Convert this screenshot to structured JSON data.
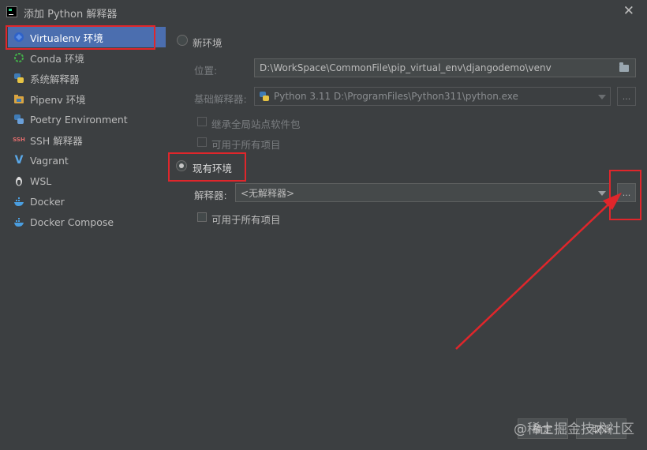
{
  "window": {
    "title": "添加 Python 解释器",
    "close_symbol": "✕"
  },
  "sidebar": {
    "items": [
      {
        "label": "Virtualenv 环境",
        "icon": "virtualenv-icon"
      },
      {
        "label": "Conda 环境",
        "icon": "conda-icon"
      },
      {
        "label": "系统解释器",
        "icon": "python-icon"
      },
      {
        "label": "Pipenv 环境",
        "icon": "pipenv-icon"
      },
      {
        "label": "Poetry Environment",
        "icon": "poetry-icon"
      },
      {
        "label": "SSH 解释器",
        "icon": "ssh-icon"
      },
      {
        "label": "Vagrant",
        "icon": "vagrant-icon"
      },
      {
        "label": "WSL",
        "icon": "linux-icon"
      },
      {
        "label": "Docker",
        "icon": "docker-icon"
      },
      {
        "label": "Docker Compose",
        "icon": "docker-compose-icon"
      }
    ],
    "ssh_icon_text": "SSH",
    "vagrant_icon_text": "V"
  },
  "new_env": {
    "radio_label": "新环境",
    "location_label": "位置:",
    "location_value": "D:\\WorkSpace\\CommonFile\\pip_virtual_env\\djangodemo\\venv",
    "base_label": "基础解释器:",
    "base_value": "Python 3.11 D:\\ProgramFiles\\Python311\\python.exe",
    "inherit_label": "继承全局站点软件包",
    "all_projects_label": "可用于所有项目"
  },
  "existing_env": {
    "radio_label": "现有环境",
    "interpreter_label": "解释器:",
    "interpreter_value": "<无解释器>",
    "all_projects_label": "可用于所有项目"
  },
  "buttons": {
    "browse_label": "...",
    "ok_label": "确定",
    "cancel_label": "取消"
  },
  "watermark": "@稀土掘金技术社区",
  "colors": {
    "background": "#3c3f41",
    "selection": "#4b6eaf",
    "highlight_red": "#e0262b"
  }
}
